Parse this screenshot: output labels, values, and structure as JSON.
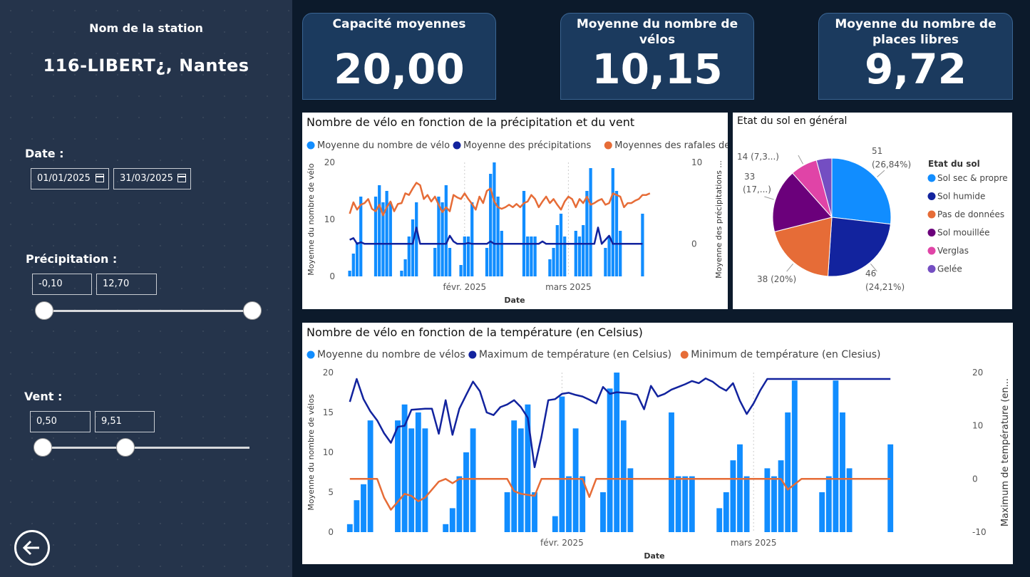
{
  "sidebar": {
    "station_label": "Nom de la station",
    "station_name": "116-LIBERT¿, Nantes",
    "date_label": "Date :",
    "date_from": "01/01/2025",
    "date_to": "31/03/2025",
    "precip_label": "Précipitation :",
    "precip_min": "-0,10",
    "precip_max": "12,70",
    "vent_label": "Vent :",
    "vent_min": "0,50",
    "vent_max": "9,51",
    "vent_slider_max_position": 0.5
  },
  "kpis": [
    {
      "title": "Capacité moyennes",
      "value": "20,00"
    },
    {
      "title": "Moyenne du nombre de vélos",
      "value": "10,15"
    },
    {
      "title": "Moyenne du nombre de places libres",
      "value": "9,72"
    }
  ],
  "colors": {
    "bar": "#118dff",
    "dark": "#12239e",
    "orange": "#e66c37"
  },
  "chart_data": [
    {
      "type": "bar",
      "title": "Nombre de vélo en fonction de la précipitation et du vent",
      "legend": [
        "Moyenne du nombre de vélo",
        "Moyenne des précipitations",
        "Moyennes des rafales de vents"
      ],
      "xlabel": "Date",
      "ylabel": "Moyenne du nombre de vélo",
      "y2label": "Moyenne des précipitations ...",
      "ylim": [
        0,
        20
      ],
      "yticks": [
        0,
        10,
        20
      ],
      "y2lim": [
        -4,
        10
      ],
      "y2ticks": [
        0,
        10
      ],
      "xticks": [
        {
          "day": 32,
          "label": "févr. 2025"
        },
        {
          "day": 60,
          "label": "mars 2025"
        }
      ],
      "days": [
        1,
        2,
        3,
        4,
        5,
        6,
        7,
        8,
        9,
        10,
        11,
        12,
        13,
        14,
        15,
        16,
        17,
        18,
        19,
        20,
        21,
        22,
        23,
        24,
        25,
        26,
        27,
        28,
        29,
        30,
        31,
        32,
        33,
        34,
        35,
        36,
        37,
        38,
        39,
        40,
        41,
        42,
        43,
        44,
        45,
        46,
        47,
        48,
        49,
        50,
        51,
        52,
        53,
        54,
        55,
        56,
        57,
        58,
        59,
        60,
        61,
        62,
        63,
        64,
        65,
        66,
        67,
        68,
        69,
        70,
        71,
        72,
        73,
        74,
        75,
        76,
        77,
        78,
        79,
        80,
        81,
        82,
        83,
        84,
        85,
        86,
        87,
        88,
        89,
        90
      ],
      "series": [
        {
          "name": "Moyenne du nombre de vélo",
          "kind": "bar",
          "values": [
            1,
            4,
            6,
            14,
            0,
            0,
            0,
            14,
            16,
            13,
            15,
            13,
            0,
            0,
            1,
            3,
            7,
            10,
            13,
            0,
            0,
            0,
            0,
            5,
            14,
            13,
            16,
            5,
            0,
            0,
            2,
            7,
            7,
            13,
            0,
            0,
            0,
            5,
            18,
            20,
            14,
            8,
            0,
            0,
            0,
            0,
            0,
            15,
            7,
            7,
            7,
            0,
            0,
            0,
            3,
            5,
            9,
            11,
            7,
            0,
            0,
            8,
            7,
            9,
            15,
            19,
            0,
            0,
            0,
            5,
            7,
            19,
            15,
            8,
            0,
            0,
            0,
            0,
            0,
            11,
            0,
            0,
            0,
            0,
            0,
            0,
            0,
            0,
            0,
            0
          ]
        },
        {
          "name": "Moyenne des précipitations",
          "kind": "line",
          "axis": "y2",
          "values": [
            0.5,
            0.7,
            0,
            0.2,
            0,
            0,
            0,
            0,
            0,
            0,
            0,
            0,
            0,
            0,
            0,
            0,
            0,
            0,
            2,
            0,
            0,
            0,
            0,
            0,
            0,
            0,
            0,
            1,
            0.3,
            0,
            0,
            0,
            0.1,
            0,
            0,
            0,
            0,
            0,
            0.3,
            0,
            0,
            0,
            0,
            0,
            0,
            0,
            0,
            0,
            0,
            0,
            0,
            0,
            0.3,
            0,
            0,
            0,
            0,
            0,
            0,
            0,
            0,
            0,
            0,
            0,
            0,
            0,
            0,
            2,
            0,
            0.5,
            1,
            0,
            0,
            0,
            0,
            0,
            0,
            0,
            0,
            0
          ]
        },
        {
          "name": "Moyennes des rafales de vents",
          "kind": "line",
          "axis": "y2",
          "values": [
            3.7,
            5.1,
            4.2,
            4.8,
            5,
            5.5,
            4.3,
            4,
            4.8,
            3.5,
            4.5,
            5.2,
            4,
            4.9,
            5,
            6.2,
            6,
            6.8,
            7.5,
            7.2,
            5.5,
            6,
            5.2,
            5.8,
            4.8,
            3.9,
            4.5,
            4,
            6,
            5.7,
            5.5,
            6.2,
            5.5,
            4.9,
            4.2,
            5.8,
            5,
            6.5,
            6.8,
            5.2,
            4.5,
            4.3,
            4.5,
            4.8,
            4.5,
            4.9,
            4.5,
            5,
            5.2,
            6,
            5.5,
            4.5,
            5.2,
            5.8,
            5,
            5.5,
            4.8,
            4.2,
            5.2,
            5.8,
            5.5,
            4.5,
            5.5,
            5,
            5.8,
            4.8,
            5,
            5.3,
            5.5,
            4.8,
            5,
            6.2,
            6,
            5.8,
            4.5,
            5,
            5,
            5.3,
            5.5,
            6,
            6,
            6.2
          ]
        }
      ]
    },
    {
      "type": "pie",
      "title": "Etat du sol en général",
      "legend_title": "Etat du sol",
      "slices": [
        {
          "label": "Sol sec & propre",
          "value": 51,
          "text": "51",
          "pct": "(26,84%)",
          "color": "#118dff"
        },
        {
          "label": "Sol humide",
          "value": 46,
          "text": "46",
          "pct": "(24,21%)",
          "color": "#12239e"
        },
        {
          "label": "Pas de données",
          "value": 38,
          "text": "38 (20%)",
          "pct": "",
          "color": "#e66c37"
        },
        {
          "label": "Sol mouillée",
          "value": 33,
          "text": "33",
          "pct": "(17,...)",
          "color": "#6b007b"
        },
        {
          "label": "Verglas",
          "value": 14,
          "text": "14 (7,3...)",
          "pct": "",
          "color": "#e044a7"
        },
        {
          "label": "Gelée",
          "value": 8,
          "text": "",
          "pct": "",
          "color": "#744ec2"
        }
      ]
    },
    {
      "type": "bar",
      "title": "Nombre de vélo en fonction de la température (en Celsius)",
      "legend": [
        "Moyenne du nombre de vélos",
        "Maximum de température (en Celsius)",
        "Minimum de température (en Clesius)"
      ],
      "xlabel": "Date",
      "ylabel": "Moyenne du nombre de vélos",
      "y2label": "Maximum de température (en...",
      "ylim": [
        0,
        20
      ],
      "yticks": [
        0,
        5,
        10,
        15,
        20
      ],
      "y2lim": [
        -10,
        20
      ],
      "y2ticks": [
        -10,
        0,
        10,
        20
      ],
      "xticks": [
        {
          "day": 32,
          "label": "févr. 2025"
        },
        {
          "day": 60,
          "label": "mars 2025"
        }
      ],
      "days": [
        1,
        2,
        3,
        4,
        5,
        6,
        7,
        8,
        9,
        10,
        11,
        12,
        13,
        14,
        15,
        16,
        17,
        18,
        19,
        20,
        21,
        22,
        23,
        24,
        25,
        26,
        27,
        28,
        29,
        30,
        31,
        32,
        33,
        34,
        35,
        36,
        37,
        38,
        39,
        40,
        41,
        42,
        43,
        44,
        45,
        46,
        47,
        48,
        49,
        50,
        51,
        52,
        53,
        54,
        55,
        56,
        57,
        58,
        59,
        60,
        61,
        62,
        63,
        64,
        65,
        66,
        67,
        68,
        69,
        70,
        71,
        72,
        73,
        74,
        75,
        76,
        77,
        78,
        79,
        80,
        81,
        82,
        83,
        84,
        85,
        86,
        87,
        88,
        89,
        90
      ],
      "series": [
        {
          "name": "Moyenne du nombre de vélos",
          "kind": "bar",
          "values": [
            1,
            4,
            6,
            14,
            0,
            0,
            0,
            14,
            16,
            13,
            15,
            13,
            0,
            0,
            1,
            3,
            7,
            10,
            13,
            0,
            0,
            0,
            0,
            5,
            14,
            13,
            16,
            5,
            0,
            0,
            2,
            17,
            7,
            13,
            7,
            0,
            0,
            5,
            18,
            20,
            14,
            8,
            0,
            0,
            0,
            0,
            0,
            15,
            7,
            7,
            7,
            0,
            0,
            0,
            3,
            5,
            9,
            11,
            7,
            0,
            0,
            8,
            7,
            9,
            15,
            19,
            0,
            0,
            0,
            5,
            7,
            19,
            15,
            8,
            0,
            0,
            0,
            0,
            0,
            11,
            0,
            0,
            0,
            0,
            0,
            0,
            0,
            0,
            0,
            0
          ]
        },
        {
          "name": "Maximum de température (en Celsius)",
          "kind": "line",
          "axis": "y2",
          "values": [
            14.5,
            18.8,
            15,
            12.7,
            11,
            8.6,
            6.8,
            9.8,
            10,
            13,
            13.1,
            13.2,
            13.2,
            8.5,
            14.8,
            8.3,
            13.2,
            15.8,
            18.3,
            16.5,
            12.5,
            12,
            13.5,
            14,
            14.8,
            13.5,
            11.5,
            2.2,
            7.9,
            14.8,
            15,
            16,
            16.2,
            15.8,
            15.5,
            14.9,
            14.2,
            17.3,
            16,
            16.3,
            16.2,
            16.1,
            15.8,
            13.1,
            17.5,
            15.5,
            16,
            16.8,
            17.3,
            17.8,
            18.4,
            18,
            18.9,
            18.3,
            17.3,
            16.6,
            18,
            14.7,
            12.2,
            14.2,
            16.7,
            18.8,
            18.8,
            18.8,
            18.8,
            18.8,
            18.8,
            18.8,
            18.8,
            18.8,
            18.8,
            18.8,
            18.8,
            18.8,
            18.8,
            18.8,
            18.8,
            18.8,
            18.8,
            18.8
          ]
        },
        {
          "name": "Minimum de température (en Clesius)",
          "kind": "line",
          "axis": "y2",
          "values": [
            0,
            0,
            0,
            0,
            0,
            -3.5,
            -5.8,
            -4.3,
            -2.8,
            -3.2,
            -4.2,
            -3.5,
            -2,
            -0.5,
            0,
            -0.8,
            0,
            0,
            0,
            0,
            0,
            0,
            0,
            0,
            -2.3,
            -2.8,
            -3,
            -3.2,
            0,
            0,
            0,
            0,
            0,
            0,
            0,
            -3.4,
            0,
            0,
            0,
            0,
            0,
            0,
            0,
            0,
            0,
            0,
            0,
            0,
            0,
            0,
            0,
            0,
            0,
            0,
            0,
            0,
            0,
            0,
            0,
            0,
            0,
            0,
            0,
            0,
            -2,
            -1,
            0,
            0,
            0,
            0,
            0,
            0,
            0,
            0,
            0,
            0,
            0,
            0,
            0,
            0
          ]
        }
      ]
    }
  ]
}
